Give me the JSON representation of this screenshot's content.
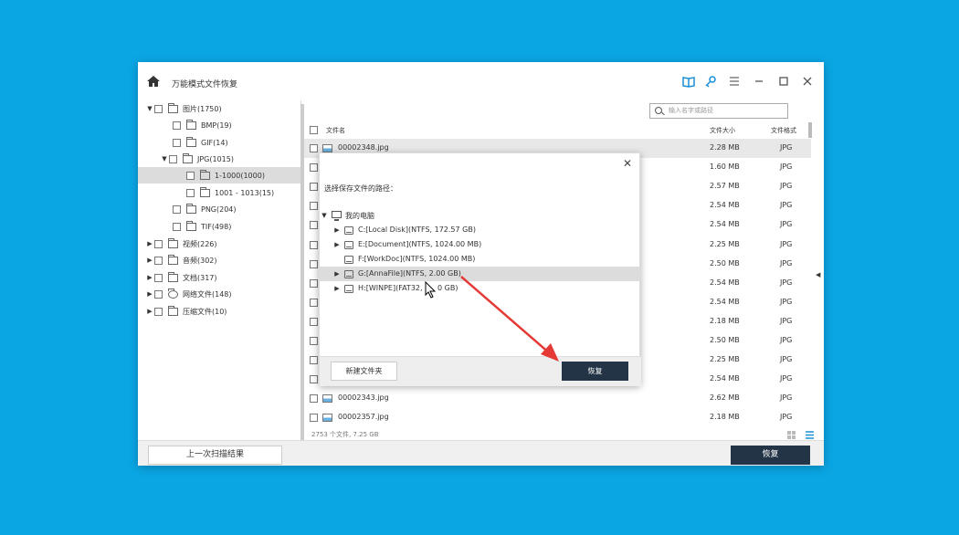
{
  "window": {
    "title": "万能模式文件恢复",
    "toolbar_icons": [
      "book-icon",
      "key-icon",
      "menu-icon",
      "minimize-icon",
      "maximize-icon",
      "close-icon"
    ]
  },
  "sidebar": {
    "items": [
      {
        "label": "图片(1750)",
        "expanded": true
      },
      {
        "label": "BMP(19)"
      },
      {
        "label": "GIF(14)"
      },
      {
        "label": "JPG(1015)",
        "expanded": true
      },
      {
        "label": "1-1000(1000)",
        "selected": true
      },
      {
        "label": "1001 -  1013(15)"
      },
      {
        "label": "PNG(204)"
      },
      {
        "label": "TIF(498)"
      },
      {
        "label": "视频(226)"
      },
      {
        "label": "音频(302)"
      },
      {
        "label": "文档(317)"
      },
      {
        "label": "网络文件(148)"
      },
      {
        "label": "压缩文件(10)"
      }
    ]
  },
  "search": {
    "placeholder": "输入名字或路径"
  },
  "table": {
    "columns": [
      "文件名",
      "文件大小",
      "文件格式"
    ],
    "rows": [
      {
        "name": "00002348.jpg",
        "size": "2.28 MB",
        "type": "JPG"
      },
      {
        "name": "",
        "size": "1.60 MB",
        "type": "JPG"
      },
      {
        "name": "",
        "size": "2.57 MB",
        "type": "JPG"
      },
      {
        "name": "",
        "size": "2.54 MB",
        "type": "JPG"
      },
      {
        "name": "",
        "size": "2.54 MB",
        "type": "JPG"
      },
      {
        "name": "",
        "size": "2.25 MB",
        "type": "JPG"
      },
      {
        "name": "",
        "size": "2.50 MB",
        "type": "JPG"
      },
      {
        "name": "",
        "size": "2.54 MB",
        "type": "JPG"
      },
      {
        "name": "",
        "size": "2.54 MB",
        "type": "JPG"
      },
      {
        "name": "",
        "size": "2.18 MB",
        "type": "JPG"
      },
      {
        "name": "",
        "size": "2.50 MB",
        "type": "JPG"
      },
      {
        "name": "",
        "size": "2.25 MB",
        "type": "JPG"
      },
      {
        "name": "",
        "size": "2.54 MB",
        "type": "JPG"
      },
      {
        "name": "00002343.jpg",
        "size": "2.62 MB",
        "type": "JPG"
      },
      {
        "name": "00002357.jpg",
        "size": "2.18 MB",
        "type": "JPG"
      }
    ]
  },
  "status": "2753 个文件, 7.25 GB",
  "footer": {
    "last_scan": "上一次扫描结果",
    "recover": "恢复"
  },
  "dialog": {
    "label": "选择保存文件的路径：",
    "root": "我的电脑",
    "drives": [
      {
        "label": "C:[Local Disk](NTFS, 172.57 GB)",
        "expandable": true
      },
      {
        "label": "E:[Document](NTFS, 1024.00 MB)",
        "expandable": true
      },
      {
        "label": "F:[WorkDoc](NTFS, 1024.00 MB)",
        "expandable": false
      },
      {
        "label": "G:[AnnaFile](NTFS, 2.00 GB)",
        "expandable": true,
        "selected": true
      },
      {
        "label": "H:[WINPE](FAT32, 2.00 GB)",
        "expandable": true
      }
    ],
    "h_label_visible": "H:[WINPE](FAT32, ",
    "h_label_tail": "0 GB)",
    "new_folder": "新建文件夹",
    "recover": "恢复"
  },
  "colors": {
    "background": "#0aa6e4",
    "dark_button": "#243447",
    "annotation": "#e53935"
  }
}
